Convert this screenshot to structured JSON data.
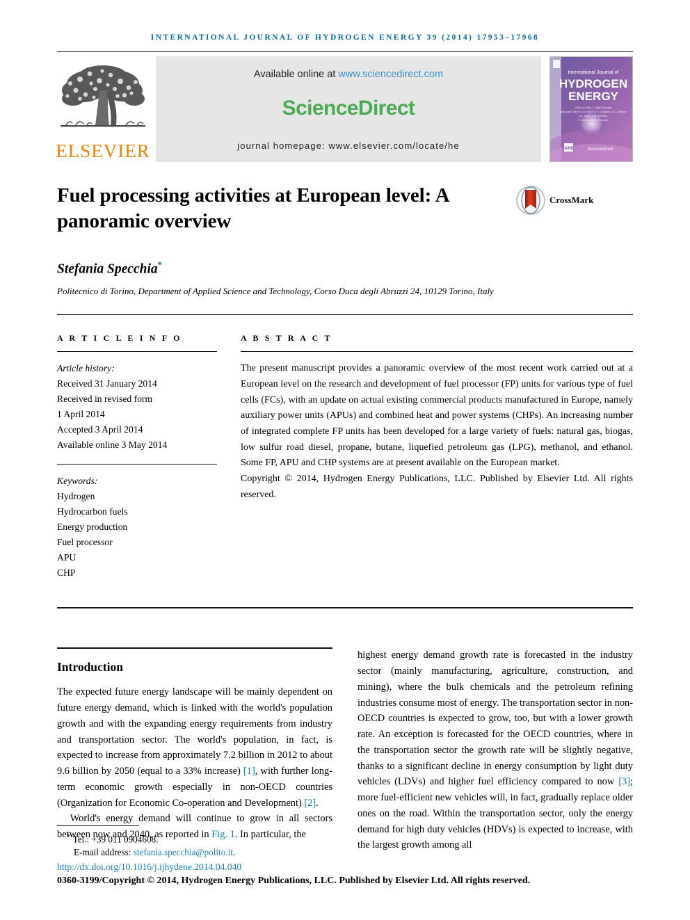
{
  "running_head": "International Journal of Hydrogen Energy 39 (2014) 17953–17968",
  "masthead": {
    "publisher_name": "ELSEVIER",
    "available_prefix": "Available online at ",
    "available_url": "www.sciencedirect.com",
    "sciencedirect_logo": "ScienceDirect",
    "journal_homepage": "journal homepage: www.elsevier.com/locate/he",
    "cover": {
      "line_small": "International Journal of",
      "line_1": "HYDROGEN",
      "line_2": "ENERGY",
      "editor_block": "Editor-in-Chief: T. Nejat Veziroglu    Associate Editors: S. A. Sherif, D. Y. Goswami, S. A. Gamboa, A. L. Dicks, J.W. Sheffield, S. Ercel and D.A. Fernando",
      "footer_brand": "ScienceDirect",
      "footer_org": "Official Journal of the IAHE"
    }
  },
  "article": {
    "title": "Fuel processing activities at European level: A panoramic overview",
    "crossmark_label": "CrossMark",
    "author": "Stefania Specchia",
    "author_marker": "*",
    "affiliation": "Politecnico di Torino, Department of Applied Science and Technology, Corso Duca degli Abruzzi 24, 10129 Torino, Italy"
  },
  "article_info": {
    "heading": "A R T I C L E   I N F O",
    "history_label": "Article history:",
    "history": [
      "Received 31 January 2014",
      "Received in revised form",
      "1 April 2014",
      "Accepted 3 April 2014",
      "Available online 3 May 2014"
    ],
    "keywords_label": "Keywords:",
    "keywords": [
      "Hydrogen",
      "Hydrocarbon fuels",
      "Energy production",
      "Fuel processor",
      "APU",
      "CHP"
    ]
  },
  "abstract": {
    "heading": "A B S T R A C T",
    "body": "The present manuscript provides a panoramic overview of the most recent work carried out at a European level on the research and development of fuel processor (FP) units for various type of fuel cells (FCs), with an update on actual existing commercial products manufactured in Europe, namely auxiliary power units (APUs) and combined heat and power systems (CHPs). An increasing number of integrated complete FP units has been developed for a large variety of fuels: natural gas, biogas, low sulfur road diesel, propane, butane, liquefied petroleum gas (LPG), methanol, and ethanol. Some FP, APU and CHP systems are at present available on the European market.",
    "copyright": "Copyright © 2014, Hydrogen Energy Publications, LLC. Published by Elsevier Ltd. All rights reserved."
  },
  "introduction": {
    "heading": "Introduction",
    "left_para_1_a": "The expected future energy landscape will be mainly dependent on future energy demand, which is linked with the world's population growth and with the expanding energy requirements from industry and transportation sector. The world's population, in fact, is expected to increase from approximately 7.2 billion in 2012 to about 9.6 billion by 2050 (equal to a 33% increase) ",
    "ref_1": "[1]",
    "left_para_1_b": ", with further long-term economic growth especially in non-OECD countries (Organization for Economic Co-operation and Development) ",
    "ref_2": "[2]",
    "left_para_1_c": ".",
    "left_para_2_a": "World's energy demand will continue to grow in all sectors between now and 2040, as reported in ",
    "fig_ref": "Fig. 1",
    "left_para_2_b": ". In particular, the",
    "right_para_a": "highest energy demand growth rate is forecasted in the industry sector (mainly manufacturing, agriculture, construction, and mining), where the bulk chemicals and the petroleum refining industries consume most of energy. The transportation sector in non-OECD countries is expected to grow, too, but with a lower growth rate. An exception is forecasted for the OECD countries, where in the transportation sector the growth rate will be slightly negative, thanks to a significant decline in energy consumption by light duty vehicles (LDVs) and higher fuel efficiency compared to now ",
    "ref_3": "[3]",
    "right_para_b": "; more fuel-efficient new vehicles will, in fact, gradually replace older ones on the road. Within the transportation sector, only the energy demand for high duty vehicles (HDVs) is expected to increase, with the largest growth among all"
  },
  "footer": {
    "tel_marker": "*",
    "tel": "Tel.: +39 011 0904608.",
    "email_label": "E-mail address: ",
    "email": "stefania.specchia@polito.it",
    "email_suffix": ".",
    "doi": "http://dx.doi.org/10.1016/j.ijhydene.2014.04.040",
    "copyright": "0360-3199/Copyright © 2014, Hydrogen Energy Publications, LLC. Published by Elsevier Ltd. All rights reserved."
  },
  "colors": {
    "link": "#1f7fbf",
    "running_head": "#0b6aa2",
    "elsevier_orange": "#ef8200",
    "sciencedirect_green": "#4caa55",
    "banner_bg": "#e6e6e6"
  }
}
